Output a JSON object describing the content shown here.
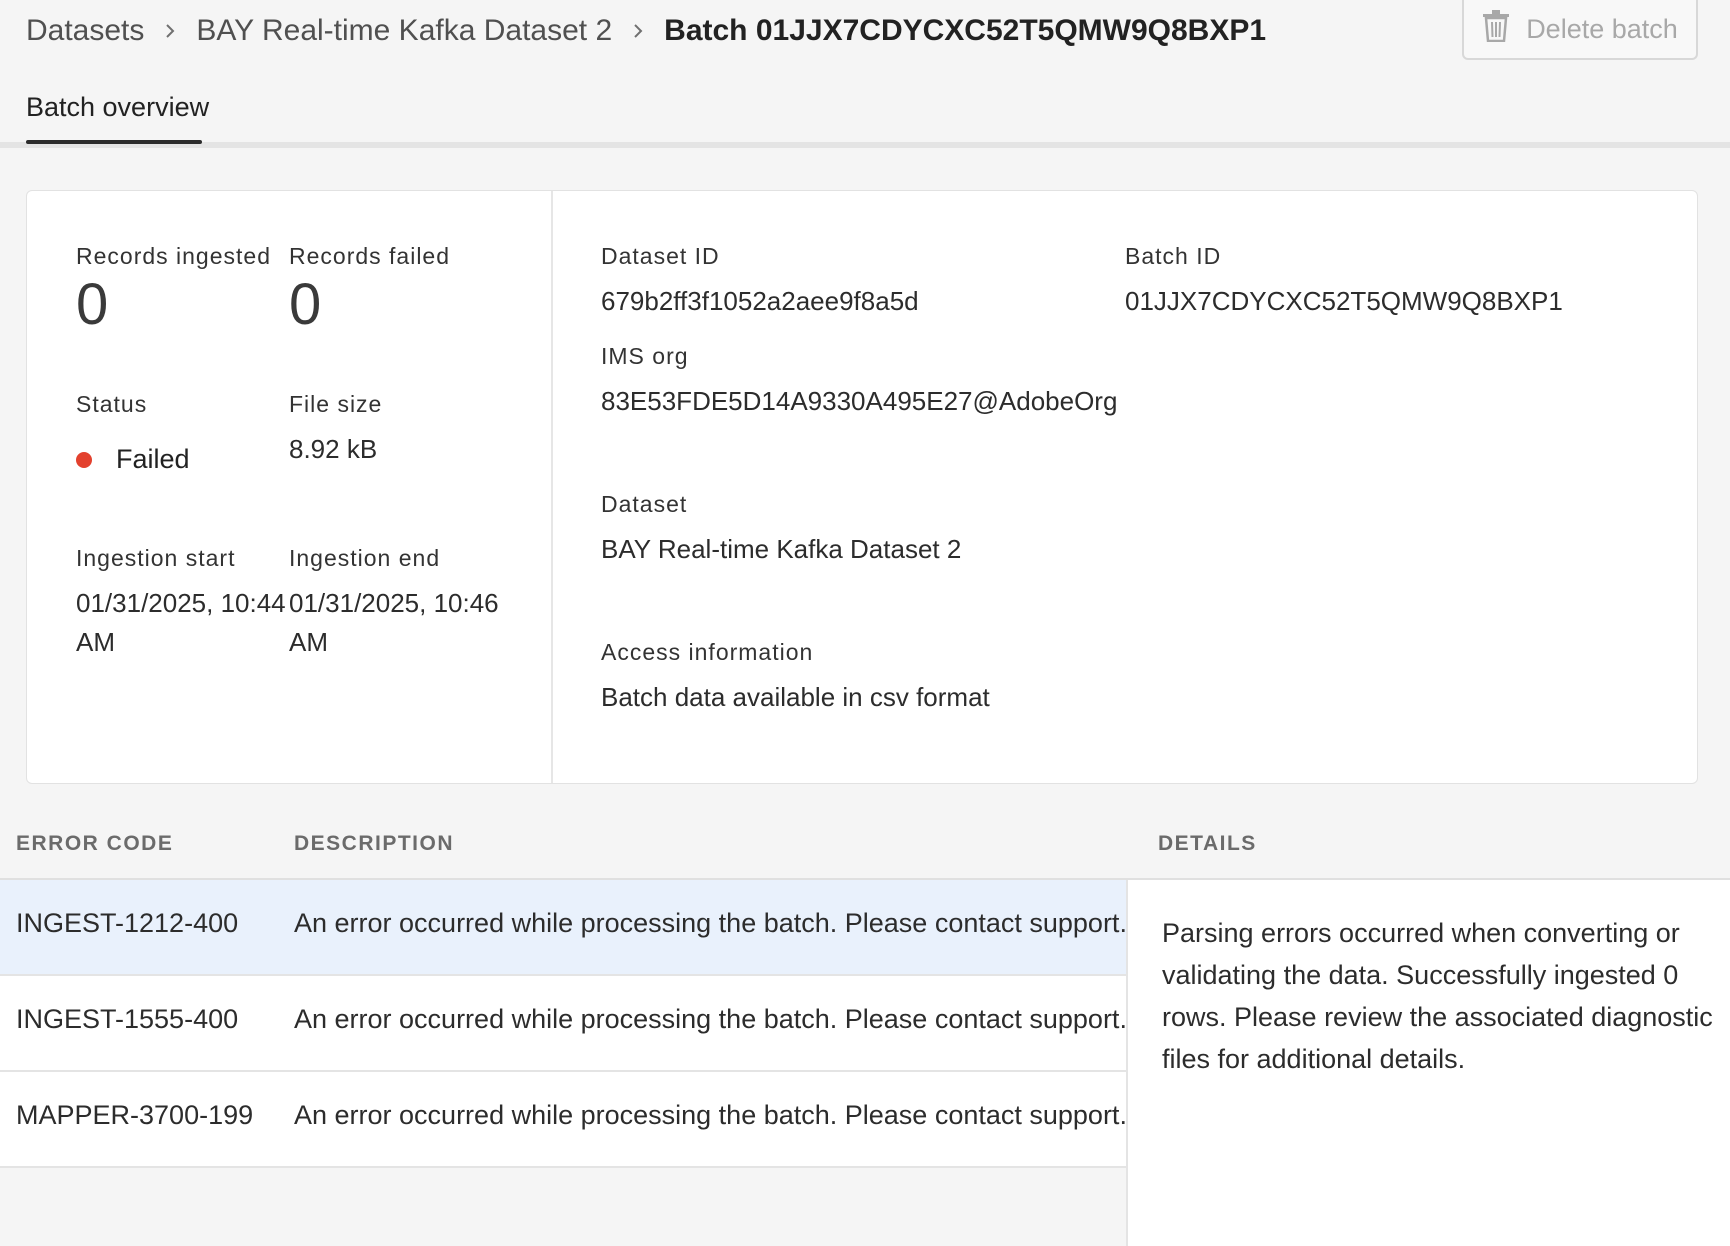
{
  "breadcrumb": {
    "items": [
      "Datasets",
      "BAY Real-time Kafka Dataset 2"
    ],
    "current": "Batch 01JJX7CDYCXC52T5QMW9Q8BXP1"
  },
  "toolbar": {
    "delete_label": "Delete batch"
  },
  "tabs": [
    {
      "label": "Batch overview"
    }
  ],
  "overview": {
    "records_ingested": {
      "label": "Records ingested",
      "value": "0"
    },
    "records_failed": {
      "label": "Records failed",
      "value": "0"
    },
    "status": {
      "label": "Status",
      "value": "Failed",
      "color": "#e3412e"
    },
    "file_size": {
      "label": "File size",
      "value": "8.92 kB"
    },
    "ingestion_start": {
      "label": "Ingestion start",
      "value_line1": "01/31/2025, 10:44",
      "value_line2": "AM"
    },
    "ingestion_end": {
      "label": "Ingestion end",
      "value_line1": "01/31/2025, 10:46",
      "value_line2": "AM"
    },
    "dataset_id": {
      "label": "Dataset ID",
      "value": "679b2ff3f1052a2aee9f8a5d"
    },
    "batch_id": {
      "label": "Batch ID",
      "value": "01JJX7CDYCXC52T5QMW9Q8BXP1"
    },
    "ims_org": {
      "label": "IMS org",
      "value": "83E53FDE5D14A9330A495E27@AdobeOrg"
    },
    "dataset": {
      "label": "Dataset",
      "value": "BAY Real-time Kafka Dataset 2"
    },
    "access_information": {
      "label": "Access information",
      "value": "Batch data available in csv format"
    }
  },
  "errors_table": {
    "columns": [
      "ERROR CODE",
      "DESCRIPTION",
      "DETAILS"
    ],
    "rows": [
      {
        "code": "INGEST-1212-400",
        "description": "An error occurred while processing the batch. Please contact support."
      },
      {
        "code": "INGEST-1555-400",
        "description": "An error occurred while processing the batch. Please contact support."
      },
      {
        "code": "MAPPER-3700-199",
        "description": "An error occurred while processing the batch. Please contact support."
      }
    ],
    "details": "Parsing errors occurred when converting or validating the data. Successfully ingested 0 rows. Please review the associated diagnostic files for additional details."
  }
}
